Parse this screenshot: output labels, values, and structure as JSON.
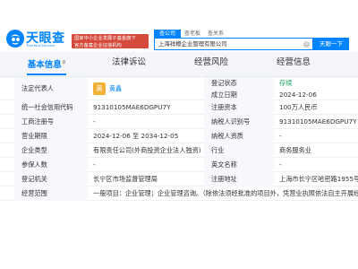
{
  "header": {
    "logo_text": "天眼查",
    "logo_sub": "TianYanCha.com",
    "promo_line1": "国家中小企业发展子基金旗下",
    "promo_line2": "官方备案企业征信机构",
    "search_tabs": [
      "查公司",
      "查老板",
      "查关系"
    ],
    "search_value": "上海祥樽企业管理有限公司",
    "search_button": "天眼一下"
  },
  "nav": {
    "tabs": [
      {
        "label": "基本信息",
        "count": "8"
      },
      {
        "label": "法律诉讼",
        "count": ""
      },
      {
        "label": "经营风险",
        "count": ""
      },
      {
        "label": "经营信息",
        "count": ""
      }
    ]
  },
  "info": {
    "legal_rep_label": "法定代表人",
    "legal_rep_avatar": "黄",
    "legal_rep_name": "黄鑫",
    "reg_status_label": "登记状态",
    "reg_status_value": "存续",
    "est_date_label": "成立日期",
    "est_date_value": "2024-12-06",
    "rows": [
      {
        "l1": "统一社会信用代码",
        "v1": "91310105MAE6DGPU7Y",
        "l2": "注册资本",
        "v2": "100万人民币"
      },
      {
        "l1": "工商注册号",
        "v1": "-",
        "l2": "纳税人识别号",
        "v2": "91310105MAE6DGPU7Y"
      },
      {
        "l1": "营业期限",
        "v1": "2024-12-06 至 2034-12-05",
        "l2": "纳税人资质",
        "v2": "-"
      },
      {
        "l1": "企业类型",
        "v1": "有限责任公司(外商投资企业法人独资)",
        "l2": "行业",
        "v2": "商务服务业"
      },
      {
        "l1": "参保人数",
        "v1": "-",
        "l2": "英文名称",
        "v2": "-"
      },
      {
        "l1": "登记机关",
        "v1": "长宁区市场监督管理局",
        "l2": "注册地址",
        "v2": "上海市长宁区哈密路1955号"
      },
      {
        "l1": "经营范围",
        "v1": "一般项目：企业管理；企业管理咨询。（除依法须经批准的项目外，凭营业执照依法自主开展经营活动）",
        "l2": "",
        "v2": ""
      }
    ]
  },
  "colors": {
    "brand": "#0084ff",
    "promo": "#d64a3b",
    "status_active": "#19a15f"
  }
}
